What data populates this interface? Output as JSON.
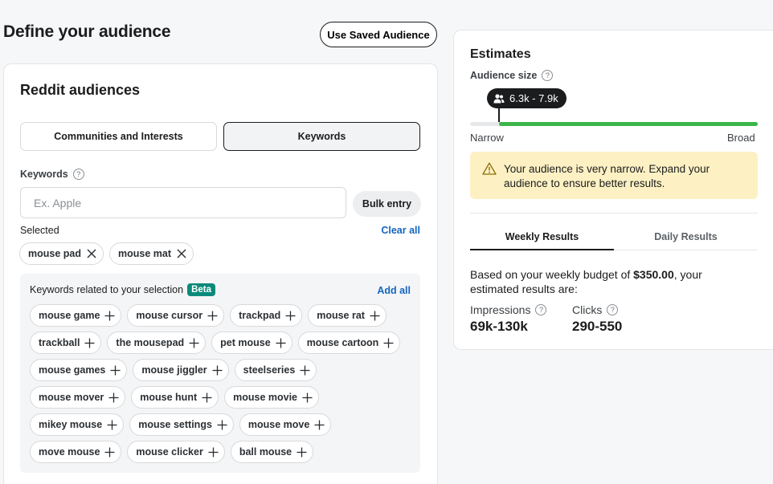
{
  "header": {
    "title": "Define your audience",
    "saved_audience_label": "Use Saved Audience"
  },
  "audiences": {
    "title": "Reddit audiences",
    "tabs": [
      {
        "label": "Communities and Interests",
        "active": false
      },
      {
        "label": "Keywords",
        "active": true
      }
    ],
    "keywords_label": "Keywords",
    "input_placeholder": "Ex. Apple",
    "input_value": "",
    "bulk_entry_label": "Bulk entry",
    "selected_label": "Selected",
    "clear_all_label": "Clear all",
    "selected": [
      "mouse pad",
      "mouse mat"
    ],
    "related": {
      "label": "Keywords related to your selection",
      "badge": "Beta",
      "add_all_label": "Add all",
      "rows": [
        [
          "mouse game",
          "mouse cursor",
          "trackpad",
          "mouse rat"
        ],
        [
          "trackball",
          "the mousepad",
          "pet mouse",
          "mouse cartoon"
        ],
        [
          "mouse games",
          "mouse jiggler",
          "steelseries"
        ],
        [
          "mouse mover",
          "mouse hunt",
          "mouse movie"
        ],
        [
          "mikey mouse",
          "mouse settings",
          "mouse move"
        ],
        [
          "move mouse",
          "mouse clicker",
          "ball mouse"
        ]
      ]
    }
  },
  "estimates": {
    "title": "Estimates",
    "audience_size_label": "Audience size",
    "audience_size_value": "6.3k - 7.9k",
    "audience_size_level": 0.1,
    "narrow_label": "Narrow",
    "broad_label": "Broad",
    "warning": "Your audience is very narrow. Expand your audience to ensure better results.",
    "tabs": [
      {
        "label": "Weekly Results",
        "active": true
      },
      {
        "label": "Daily Results",
        "active": false
      }
    ],
    "budget_prefix": "Based on your weekly budget of ",
    "budget_amount": "$350.00",
    "budget_suffix": ", your estimated results are:",
    "metrics": [
      {
        "label": "Impressions",
        "value": "69k-130k"
      },
      {
        "label": "Clicks",
        "value": "290-550"
      }
    ]
  },
  "colors": {
    "accent_link": "#1565c0",
    "beta_badge": "#0b8a7a",
    "bar_fill": "#3cb54a",
    "warning_bg": "#fdf1c4"
  },
  "icons": {
    "remove": "close-icon",
    "add": "plus-icon",
    "help": "help-icon",
    "audience": "people-icon",
    "warning": "warning-icon"
  }
}
